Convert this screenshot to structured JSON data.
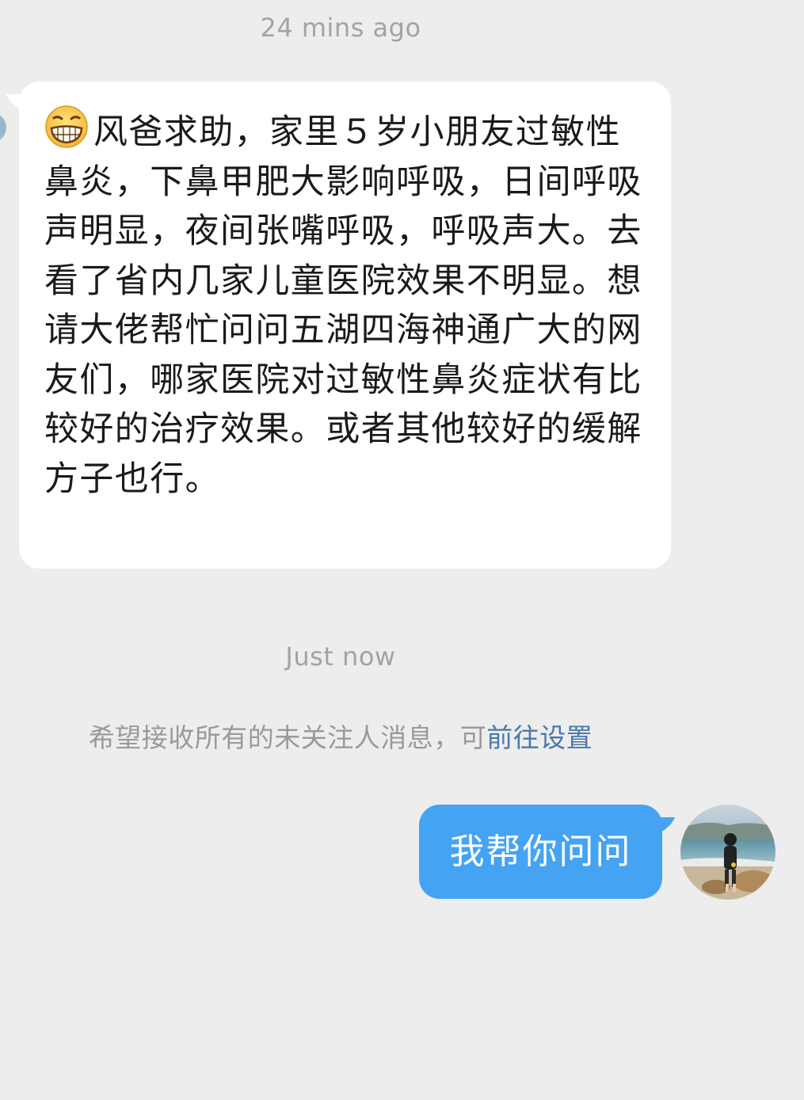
{
  "chat": {
    "timestamp_1": "24 mins ago",
    "incoming_message": {
      "emoji": "grinning-face-icon",
      "text": "风爸求助，家里５岁小朋友过敏性鼻炎，下鼻甲肥大影响呼吸，日间呼吸声明显，夜间张嘴呼吸，呼吸声大。去看了省内几家儿童医院效果不明显。想请大佬帮忙问问五湖四海神通广大的网友们，哪家医院对过敏性鼻炎症状有比较好的治疗效果。或者其他较好的缓解方子也行。"
    },
    "timestamp_2": "Just now",
    "notice": {
      "text": "希望接收所有的未关注人消息，可",
      "link": "前往设置"
    },
    "outgoing_message": {
      "text": "我帮你问问"
    }
  },
  "colors": {
    "background": "#ededed",
    "incoming_bubble": "#ffffff",
    "outgoing_bubble": "#45a3f4",
    "link": "#4a78a8"
  }
}
